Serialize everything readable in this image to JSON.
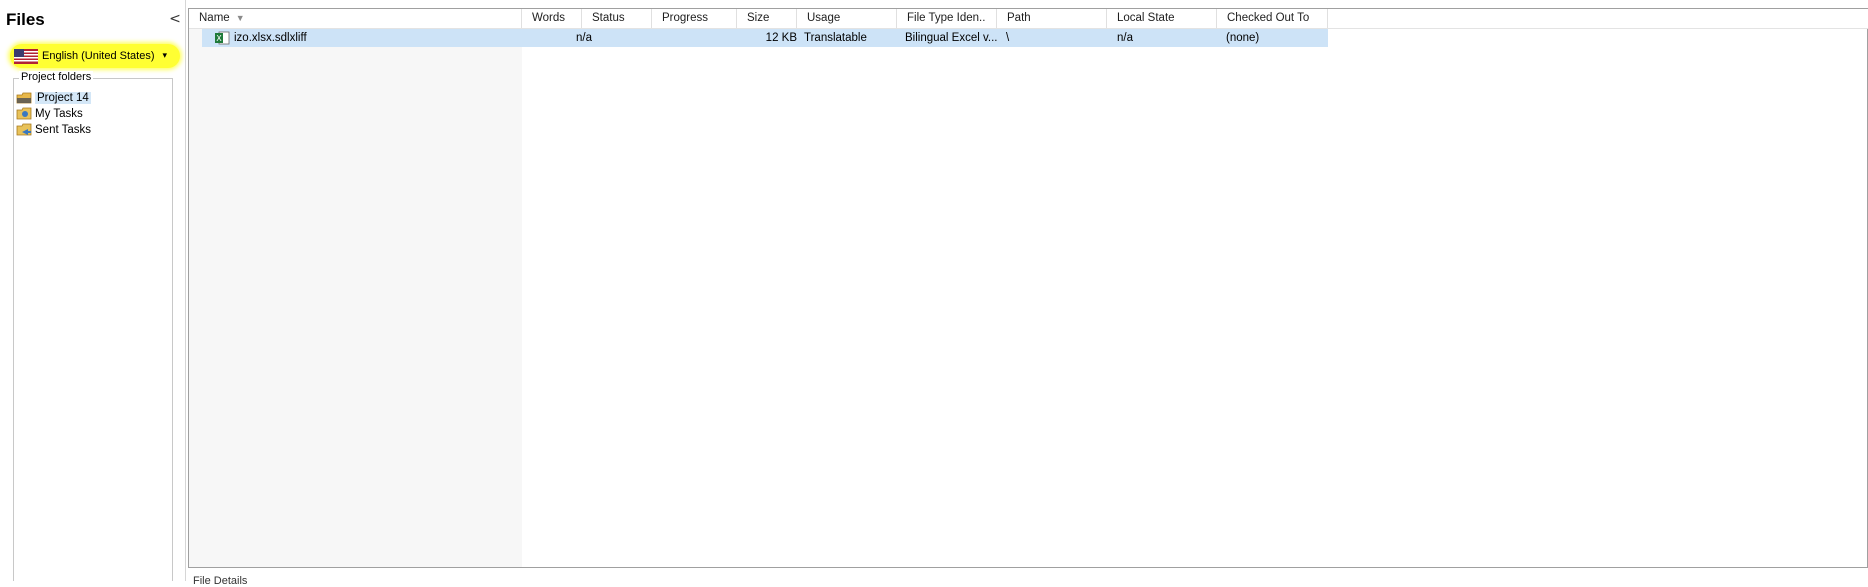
{
  "nav": {
    "title": "Files",
    "collapse_glyph": "<",
    "language": {
      "label": "English (United States)",
      "arrow": "▾",
      "flag_icon": "us-flag-icon"
    },
    "folders_legend": "Project folders",
    "folders": [
      {
        "label": "Project 14",
        "icon": "project-folder-icon",
        "selected": true
      },
      {
        "label": "My Tasks",
        "icon": "my-tasks-icon",
        "selected": false
      },
      {
        "label": "Sent Tasks",
        "icon": "sent-tasks-icon",
        "selected": false
      }
    ]
  },
  "grid": {
    "columns": [
      "Name",
      "Words",
      "Status",
      "Progress",
      "Size",
      "Usage",
      "File Type Iden..",
      "Path",
      "Local State",
      "Checked Out To"
    ],
    "sort_glyph": "▼",
    "rows": [
      {
        "name": "izo.xlsx.sdlxliff",
        "words": "n/a",
        "status": "",
        "progress": "",
        "size": "12 KB",
        "usage": "Translatable",
        "file_type": "Bilingual Excel v...",
        "path": "\\",
        "local_state": "n/a",
        "checked_out_to": "(none)",
        "icon": "excel-file-icon"
      }
    ]
  },
  "bottom": {
    "label": "File Details"
  },
  "colors": {
    "highlight": "#ffff33",
    "selection": "#cde3f7"
  }
}
